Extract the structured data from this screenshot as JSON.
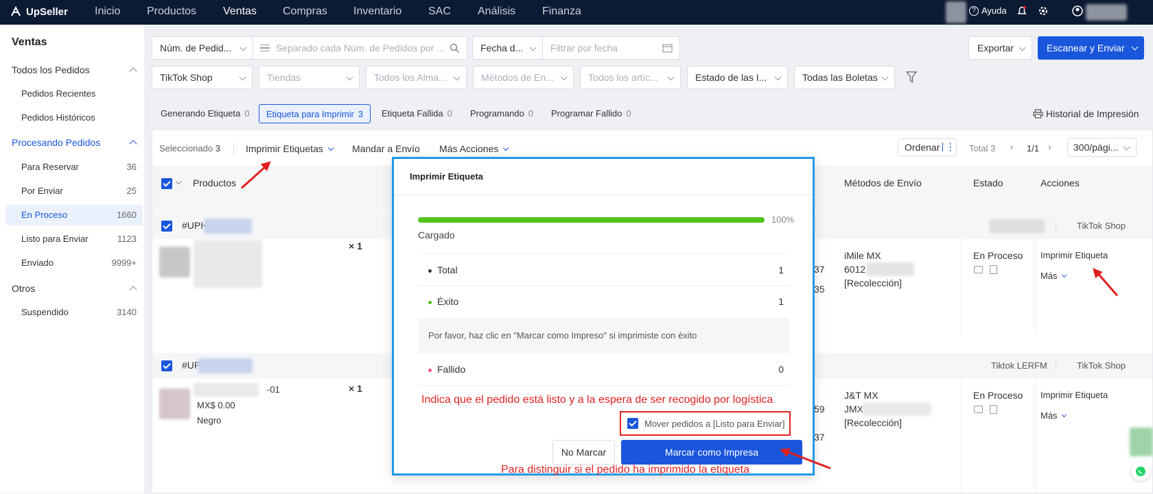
{
  "nav": {
    "brand": "UpSeller",
    "items": [
      "Inicio",
      "Productos",
      "Ventas",
      "Compras",
      "Inventario",
      "SAC",
      "Análisis",
      "Finanza"
    ],
    "active": "Ventas",
    "help": "Ayuda"
  },
  "sidebar": {
    "title": "Ventas",
    "groups": [
      {
        "label": "Todos los Pedidos",
        "items": [
          {
            "label": "Pedidos Recientes",
            "count": ""
          },
          {
            "label": "Pedidos Históricos",
            "count": ""
          }
        ]
      },
      {
        "label": "Procesando Pedidos",
        "items": [
          {
            "label": "Para Reservar",
            "count": "36"
          },
          {
            "label": "Por Enviar",
            "count": "25"
          },
          {
            "label": "En Proceso",
            "count": "1660"
          },
          {
            "label": "Listo para Enviar",
            "count": "1123"
          },
          {
            "label": "Enviado",
            "count": "9999+"
          }
        ]
      },
      {
        "label": "Otros",
        "items": [
          {
            "label": "Suspendido",
            "count": "3140"
          }
        ]
      }
    ]
  },
  "filters": {
    "order_num": "Núm. de Pedid...",
    "search_placeholder": "Separado cada Núm. de Pedidos por ...",
    "date_type": "Fecha d...",
    "date_placeholder": "Filtrar por fecha",
    "platform": "TikTok Shop",
    "stores": "Tiendas",
    "warehouses": "Todos los Alma...",
    "shipping": "Métodos de En...",
    "items": "Todos los artíc...",
    "status": "Estado de las I...",
    "invoices": "Todas las Boletas"
  },
  "buttons": {
    "export": "Exportar",
    "scan": "Escanear y Enviar"
  },
  "tabs": [
    {
      "label": "Generando Etiqueta",
      "count": "0"
    },
    {
      "label": "Etiqueta para Imprimir",
      "count": "3"
    },
    {
      "label": "Etiqueta Fallida",
      "count": "0"
    },
    {
      "label": "Programando",
      "count": "0"
    },
    {
      "label": "Programar Fallido",
      "count": "0"
    }
  ],
  "history": "Historial de Impresión",
  "actions": {
    "selected_label": "Seleccionado",
    "selected_count": "3",
    "print_labels": "Imprimir Etiquetas",
    "send": "Mandar a Envío",
    "more": "Más Acciones",
    "sort": "Ordenar",
    "total": "Total 3",
    "page": "1/1",
    "per_page": "300/pági..."
  },
  "columns": {
    "products": "Productos",
    "shipping": "Métodos de Envío",
    "status": "Estado",
    "actions": "Acciones"
  },
  "orders": [
    {
      "id_prefix": "#UPH",
      "qty": "× 1",
      "carrier_tag": "",
      "store": "TikTok Shop",
      "price": "",
      "variant": "",
      "sku_suffix": "",
      "ship_name": "iMile MX",
      "ship_prefix": "6012",
      "ship_note": "[Recolección]",
      "status": "En Proceso",
      "action": "Imprimir Etiqueta",
      "more": "Más",
      "partial": [
        "37",
        "35"
      ]
    },
    {
      "id_prefix": "#UP",
      "qty": "× 1",
      "carrier_tag": "Tiktok LERFM",
      "store": "TikTok Shop",
      "price": "MX$ 0.00",
      "variant": "Negro",
      "sku_suffix": "-01",
      "ship_name": "J&T MX",
      "ship_prefix": "JMX",
      "ship_note": "[Recolección]",
      "status": "En Proceso",
      "action": "Imprimir Etiqueta",
      "more": "Más",
      "partial": [
        "59",
        "37"
      ]
    }
  ],
  "modal": {
    "title": "Imprimir Etiqueta",
    "progress": 1.0,
    "progress_text": "100%",
    "loaded": "Cargado",
    "total_label": "Total",
    "total_value": "1",
    "success_label": "Éxito",
    "success_value": "1",
    "note": "Por favor, haz clic en \"Marcar como Impreso\" si imprimiste con éxito",
    "failed_label": "Fallido",
    "failed_value": "0",
    "checkbox_label": "Mover pedidos a [Listo para Enviar]",
    "no_mark": "No Marcar",
    "mark_printed": "Marcar como Impresa"
  },
  "annotations": {
    "ready": "Indica que el pedido está listo y a la espera de ser recogido por logística",
    "distinguish": "Para distinguir si el pedido ha imprimido la etiqueta"
  },
  "colors": {
    "primary": "#1a56db",
    "nav_bg": "#0c1a33",
    "success": "#52c41a",
    "annotation": "#e02020",
    "modal_border": "#1e9be8"
  }
}
